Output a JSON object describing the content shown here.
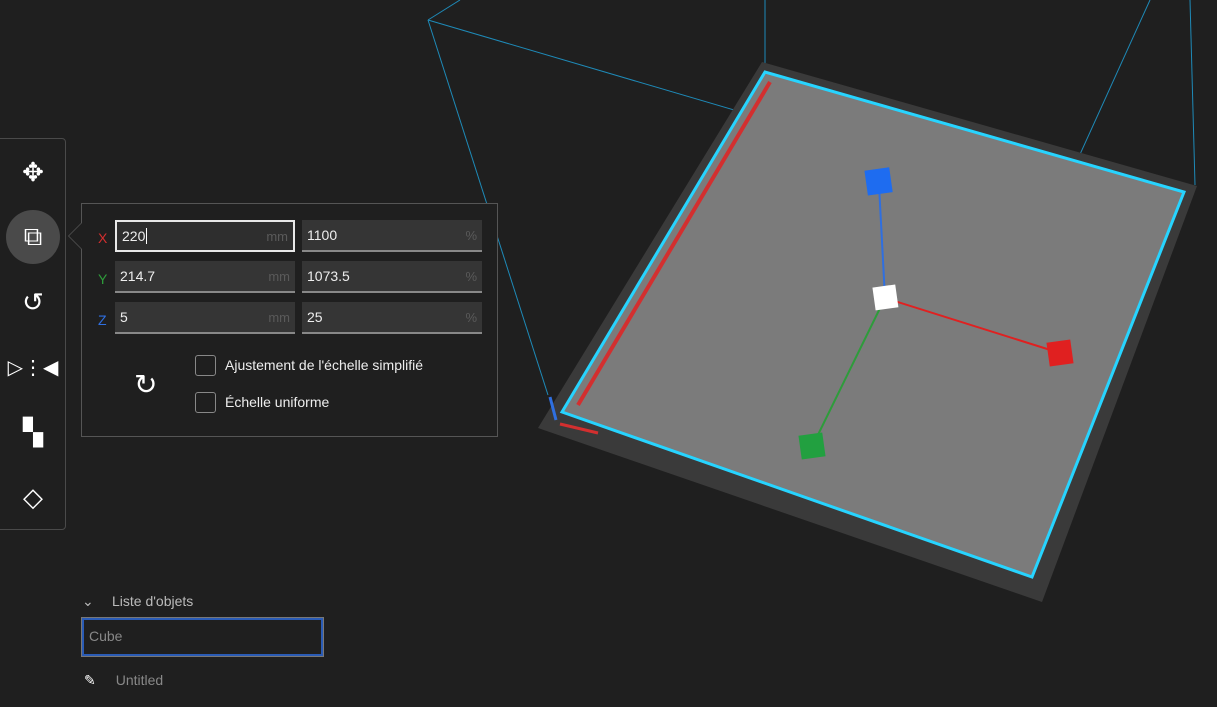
{
  "toolbar": {
    "tools": [
      "move-tool",
      "scale-tool",
      "rotate-tool",
      "mirror-tool",
      "per-model-settings-tool",
      "support-blocker-tool"
    ],
    "active": "scale-tool"
  },
  "scale_panel": {
    "rows": [
      {
        "axis": "X",
        "color": "#d32f2f",
        "mm": "220",
        "percent": "1100"
      },
      {
        "axis": "Y",
        "color": "#2e9c3b",
        "mm": "214.7",
        "percent": "1073.5"
      },
      {
        "axis": "Z",
        "color": "#2f6fe0",
        "mm": "5",
        "percent": "25"
      }
    ],
    "unit_mm": "mm",
    "unit_percent": "%",
    "snap_scaling_label": "Ajustement de l'échelle simplifié",
    "snap_scaling_checked": false,
    "uniform_scaling_label": "Échelle uniforme",
    "uniform_scaling_checked": false
  },
  "object_list": {
    "header": "Liste d'objets",
    "selected": "Cube",
    "job_name": "Untitled"
  },
  "colors": {
    "background": "#1f1f1f",
    "plate": "#7a7a7a",
    "outline": "#27d4ff",
    "bbox": "#1e8ab8"
  }
}
